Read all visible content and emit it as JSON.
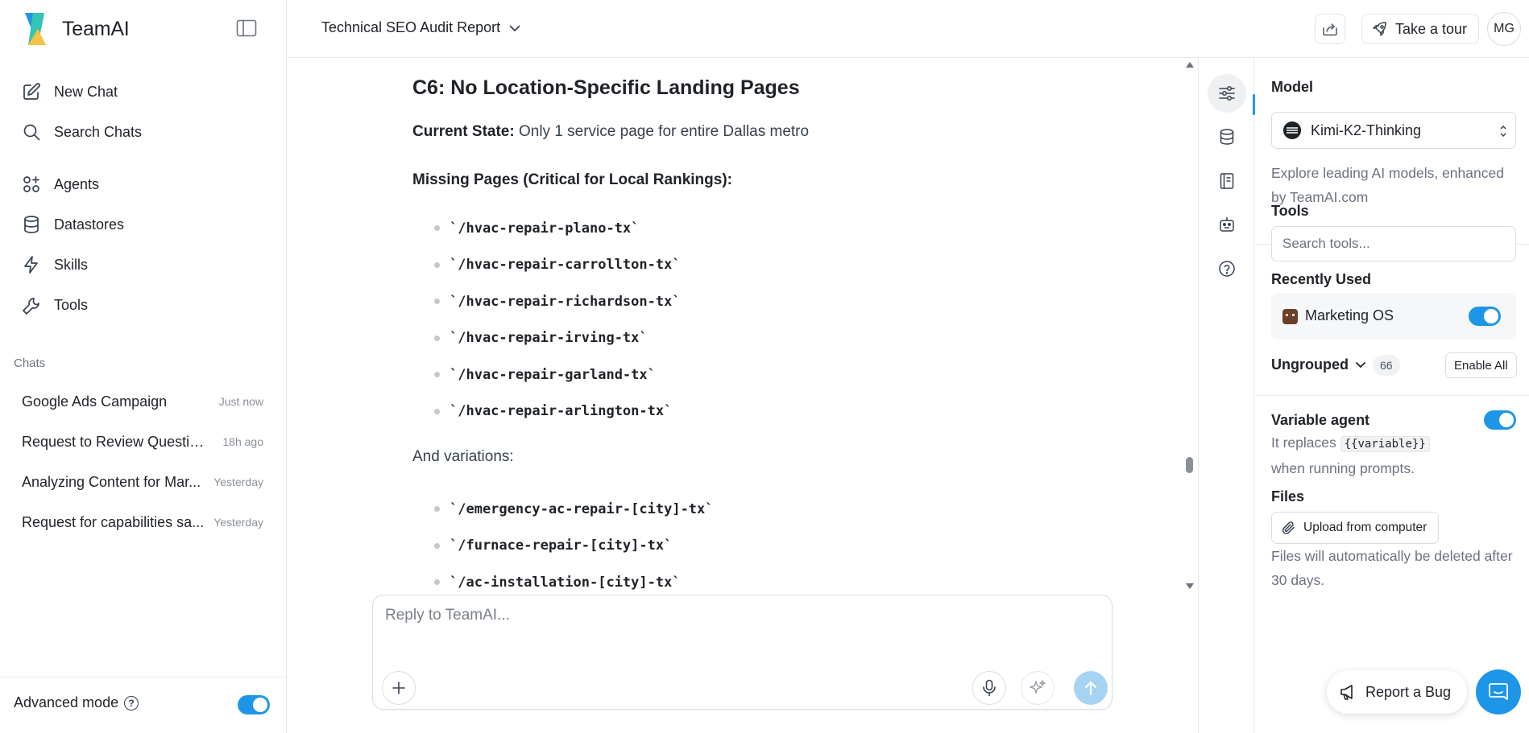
{
  "brand": {
    "name": "TeamAI"
  },
  "sidebar": {
    "nav": [
      {
        "label": "New Chat",
        "icon": "edit-icon"
      },
      {
        "label": "Search Chats",
        "icon": "search-icon"
      },
      {
        "label": "Agents",
        "icon": "agents-icon"
      },
      {
        "label": "Datastores",
        "icon": "database-icon"
      },
      {
        "label": "Skills",
        "icon": "lightning-icon"
      },
      {
        "label": "Tools",
        "icon": "wrench-icon"
      }
    ],
    "chats_heading": "Chats",
    "chats": [
      {
        "title": "Google Ads Campaign",
        "time": "Just now"
      },
      {
        "title": "Request to Review Question...",
        "time": "18h ago"
      },
      {
        "title": "Analyzing Content for Mar...",
        "time": "Yesterday"
      },
      {
        "title": "Request for capabilities sa...",
        "time": "Yesterday"
      }
    ],
    "advanced_mode": {
      "label": "Advanced mode",
      "enabled": true
    }
  },
  "header": {
    "title": "Technical SEO Audit Report",
    "take_tour": "Take a tour",
    "avatar": "MG"
  },
  "message": {
    "heading": "C6: No Location-Specific Landing Pages",
    "current_state_label": "Current State:",
    "current_state_text": "Only 1 service page for entire Dallas metro",
    "missing_heading": "Missing Pages (Critical for Local Rankings):",
    "missing_pages": [
      "`/hvac-repair-plano-tx`",
      "`/hvac-repair-carrollton-tx`",
      "`/hvac-repair-richardson-tx`",
      "`/hvac-repair-irving-tx`",
      "`/hvac-repair-garland-tx`",
      "`/hvac-repair-arlington-tx`"
    ],
    "variations_label": "And variations:",
    "variations": [
      "`/emergency-ac-repair-[city]-tx`",
      "`/furnace-repair-[city]-tx`",
      "`/ac-installation-[city]-tx`"
    ]
  },
  "composer": {
    "placeholder": "Reply to TeamAI..."
  },
  "panel": {
    "model_label": "Model",
    "model_value": "Kimi-K2-Thinking",
    "model_desc": "Explore leading AI models, enhanced by TeamAI.com",
    "tools_label": "Tools",
    "tools_search_placeholder": "Search tools...",
    "recently_used_label": "Recently Used",
    "recent_tool": {
      "name": "Marketing OS",
      "enabled": true
    },
    "ungrouped_label": "Ungrouped",
    "ungrouped_count": "66",
    "enable_all": "Enable All",
    "variable_agent_label": "Variable agent",
    "variable_agent_enabled": true,
    "variable_desc_pre": "It replaces",
    "variable_code": "{{variable}}",
    "variable_desc_post": "when running prompts.",
    "files_label": "Files",
    "upload_label": "Upload from computer",
    "files_note": "Files will automatically be deleted after 30 days."
  },
  "report_bug": "Report a Bug",
  "colors": {
    "accent": "#1e96e8",
    "send_disabled": "#a7d3f3"
  }
}
